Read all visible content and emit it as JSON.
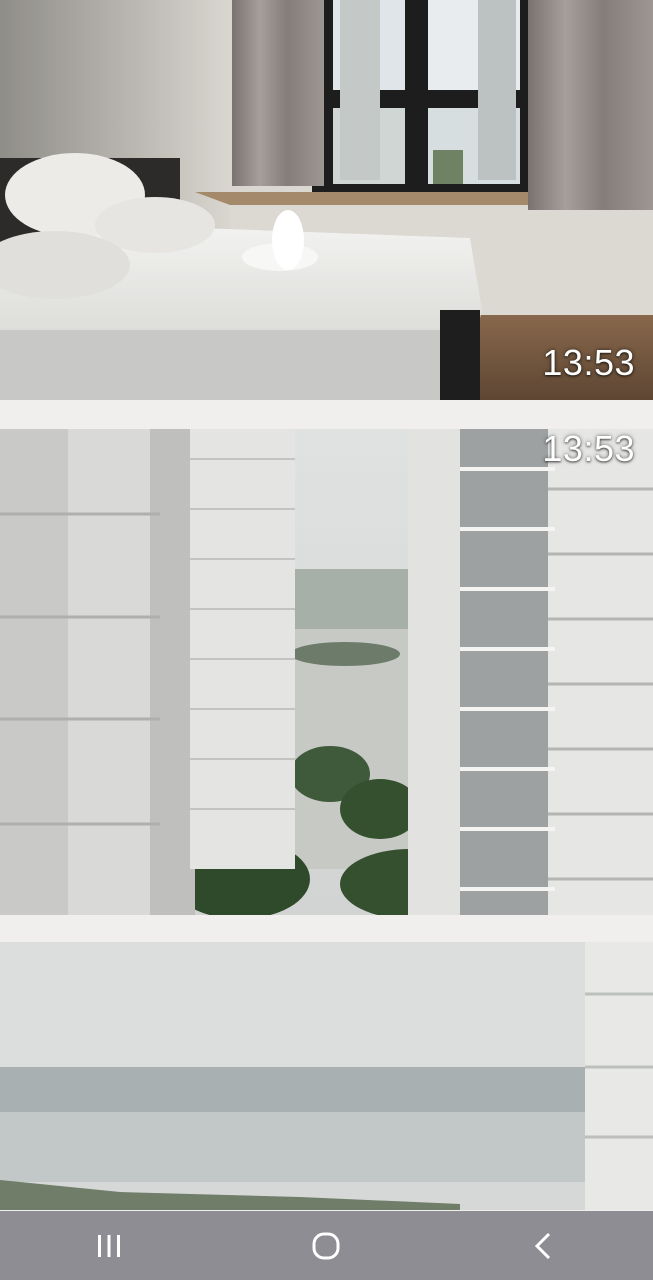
{
  "gallery": {
    "items": [
      {
        "name": "bedroom-photo",
        "timestamp": "13:53"
      },
      {
        "name": "tower-view-photo",
        "timestamp": "13:53"
      },
      {
        "name": "lake-view-photo",
        "timestamp": ""
      }
    ]
  },
  "navbar": {
    "recent_apps": {
      "icon": "recent-apps-icon"
    },
    "home": {
      "icon": "home-icon"
    },
    "back": {
      "icon": "back-icon"
    }
  },
  "colors": {
    "background": "#f1efee",
    "navbar": "#8e8d93",
    "timestamp_text": "#ffffff"
  }
}
